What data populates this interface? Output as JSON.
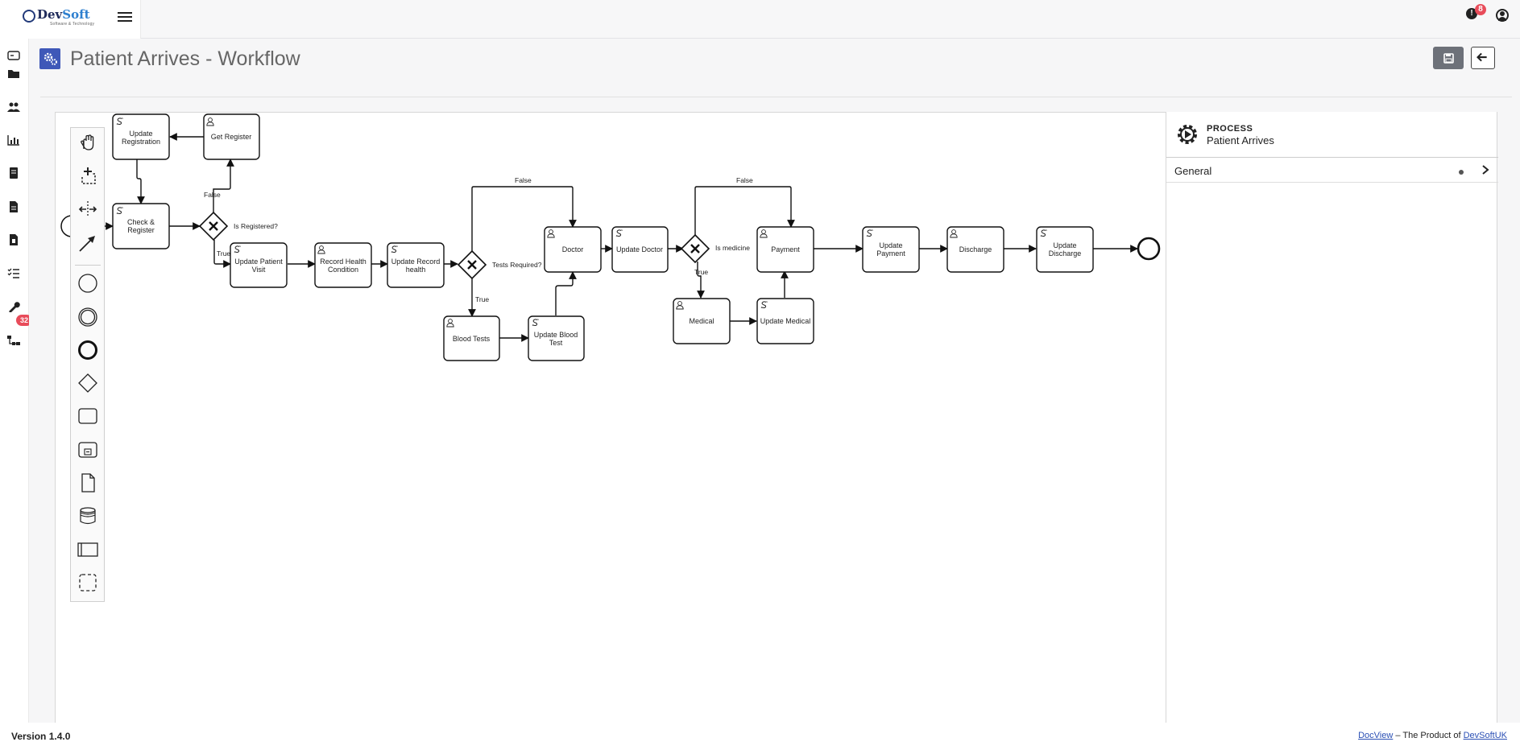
{
  "brand": {
    "name_part1": "Dev",
    "name_part2": "Soft",
    "tagline": "Software & Technology"
  },
  "topbar": {
    "notifications_count": "8",
    "alert_glyph": "!"
  },
  "sidebar": {
    "tasks_badge": "32"
  },
  "page": {
    "title": "Patient Arrives - Workflow"
  },
  "diagram": {
    "nodes": [
      {
        "id": "update-registration",
        "type": "service",
        "lines": [
          "Update",
          "Registration"
        ]
      },
      {
        "id": "get-register",
        "type": "user",
        "lines": [
          "Get Register"
        ]
      },
      {
        "id": "check-register",
        "type": "service",
        "lines": [
          "Check &",
          "Register"
        ]
      },
      {
        "id": "update-patient-visit",
        "type": "service",
        "lines": [
          "Update Patient",
          "Visit"
        ]
      },
      {
        "id": "record-health-condition",
        "type": "user",
        "lines": [
          "Record Health",
          "Condition"
        ]
      },
      {
        "id": "update-record-health",
        "type": "service",
        "lines": [
          "Update Record",
          "health"
        ]
      },
      {
        "id": "doctor",
        "type": "user",
        "lines": [
          "Doctor"
        ]
      },
      {
        "id": "update-doctor",
        "type": "service",
        "lines": [
          "Update Doctor"
        ]
      },
      {
        "id": "blood-tests",
        "type": "user",
        "lines": [
          "Blood Tests"
        ]
      },
      {
        "id": "update-blood-test",
        "type": "service",
        "lines": [
          "Update Blood",
          "Test"
        ]
      },
      {
        "id": "payment",
        "type": "user",
        "lines": [
          "Payment"
        ]
      },
      {
        "id": "medical",
        "type": "user",
        "lines": [
          "Medical"
        ]
      },
      {
        "id": "update-medical",
        "type": "service",
        "lines": [
          "Update Medical"
        ]
      },
      {
        "id": "update-payment",
        "type": "service",
        "lines": [
          "Update",
          "Payment"
        ]
      },
      {
        "id": "discharge",
        "type": "user",
        "lines": [
          "Discharge"
        ]
      },
      {
        "id": "update-discharge",
        "type": "service",
        "lines": [
          "Update",
          "Discharge"
        ]
      }
    ],
    "gateways": [
      {
        "id": "is-registered",
        "label": "Is Registered?"
      },
      {
        "id": "tests-required",
        "label": "Tests Required?"
      },
      {
        "id": "is-medicine",
        "label": "Is medicine"
      }
    ],
    "edge_labels": {
      "false1": "False",
      "true1": "True",
      "false2": "False",
      "true2": "True",
      "false3": "False",
      "true3": "True"
    }
  },
  "properties": {
    "type_label": "PROCESS",
    "process_name": "Patient Arrives",
    "group_label": "General"
  },
  "footer": {
    "version": "Version 1.4.0",
    "docview_link": "DocView",
    "separator": "–",
    "product_text": "The Product of",
    "devsoft_link": "DevSoftUK"
  }
}
